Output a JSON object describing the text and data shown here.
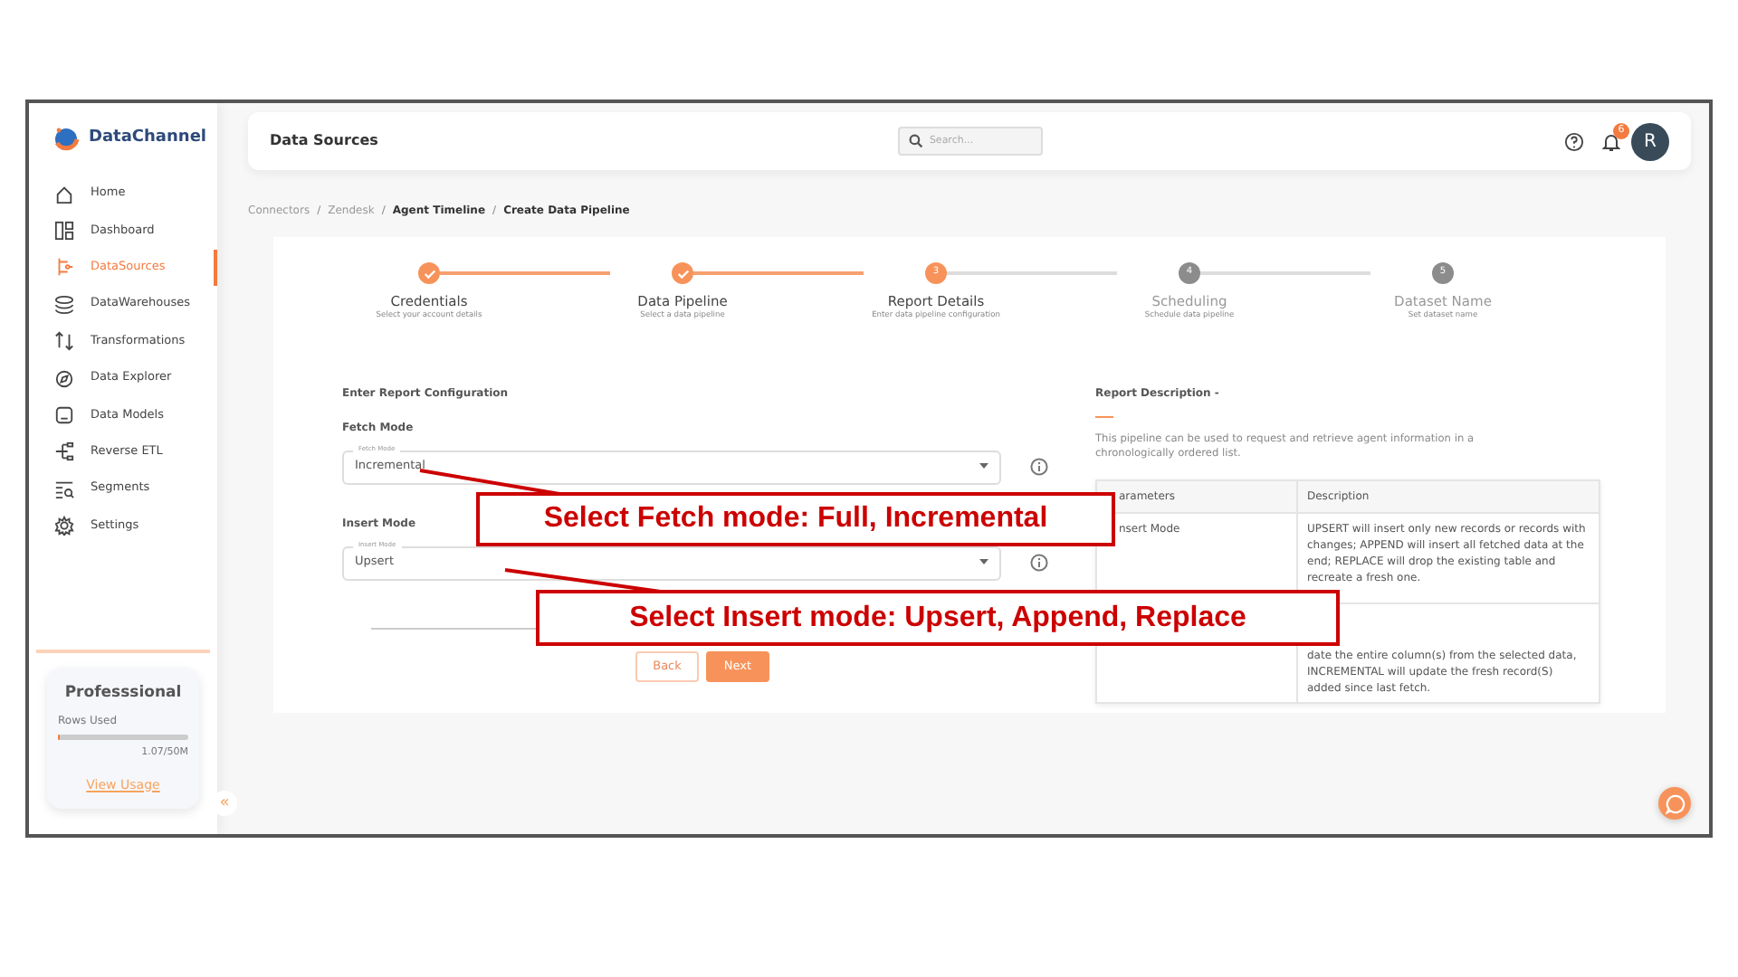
{
  "sidebar": {
    "logo": "DataChannel",
    "items": [
      {
        "label": "Home",
        "selected": false
      },
      {
        "label": "Dashboard",
        "selected": false
      },
      {
        "label": "DataSources",
        "selected": true
      },
      {
        "label": "DataWarehouses",
        "selected": false
      },
      {
        "label": "Transformations",
        "selected": false
      },
      {
        "label": "Data Explorer",
        "selected": false
      },
      {
        "label": "Data Models",
        "selected": false
      },
      {
        "label": "Reverse ETL",
        "selected": false
      },
      {
        "label": "Segments",
        "selected": false
      },
      {
        "label": "Settings",
        "selected": false
      }
    ],
    "plan": {
      "title": "Professsional",
      "rows_label": "Rows Used",
      "level": 0.02,
      "reading": "1.07/50M",
      "link": "View Usage"
    },
    "collapse": "«"
  },
  "header": {
    "title": "Data Sources",
    "search": {
      "placeholder": "Search..."
    },
    "notifications": "6",
    "avatar": "R"
  },
  "breadcrumb": {
    "separators": [
      "/",
      "/",
      "/"
    ],
    "items": [
      {
        "label": "Connectors",
        "emphasis": false
      },
      {
        "label": "Zendesk",
        "emphasis": false
      },
      {
        "label": "Agent Timeline",
        "emphasis": true
      },
      {
        "label": "Create Data Pipeline",
        "emphasis": true
      }
    ]
  },
  "steps": [
    {
      "title": "Credentials",
      "subtitle": "Select your account details",
      "kind": "done"
    },
    {
      "title": "Data Pipeline",
      "subtitle": "Select a data pipeline",
      "kind": "done"
    },
    {
      "title": "Report Details",
      "subtitle": "Enter data pipeline configuration",
      "kind": "current",
      "number": "3"
    },
    {
      "title": "Scheduling",
      "subtitle": "Schedule data pipeline",
      "kind": "pending",
      "number": "4"
    },
    {
      "title": "Dataset Name",
      "subtitle": "Set dataset name",
      "kind": "pending",
      "number": "5"
    }
  ],
  "form": {
    "heading": "Enter Report Configuration",
    "fields": [
      {
        "label": "Fetch Mode",
        "floating_label": "Fetch Mode",
        "value": "Incremental"
      },
      {
        "label": "Insert Mode",
        "floating_label": "Insert Mode",
        "value": "Upsert"
      }
    ],
    "buttons": [
      {
        "label": "Back",
        "disabled": true
      },
      {
        "label": "Next",
        "disabled": false
      }
    ]
  },
  "description": {
    "title": "Report Description -",
    "text": "This pipeline can be used to request and retrieve agent information in a chronologically ordered list.",
    "columns": [
      "arameters",
      "Description"
    ],
    "rows": [
      [
        "nsert Mode",
        "UPSERT will insert only new records or records with changes; APPEND will insert all fetched data at the end; REPLACE will drop the existing table and recreate a fresh one."
      ],
      [
        "",
        "date the entire column(s) from the selected data, INCREMENTAL will update the fresh record(S) added since last fetch."
      ]
    ]
  },
  "callouts": [
    {
      "text": "Select Fetch mode: Full, Incremental"
    },
    {
      "text": "Select Insert mode: Upsert, Append, Replace"
    }
  ]
}
